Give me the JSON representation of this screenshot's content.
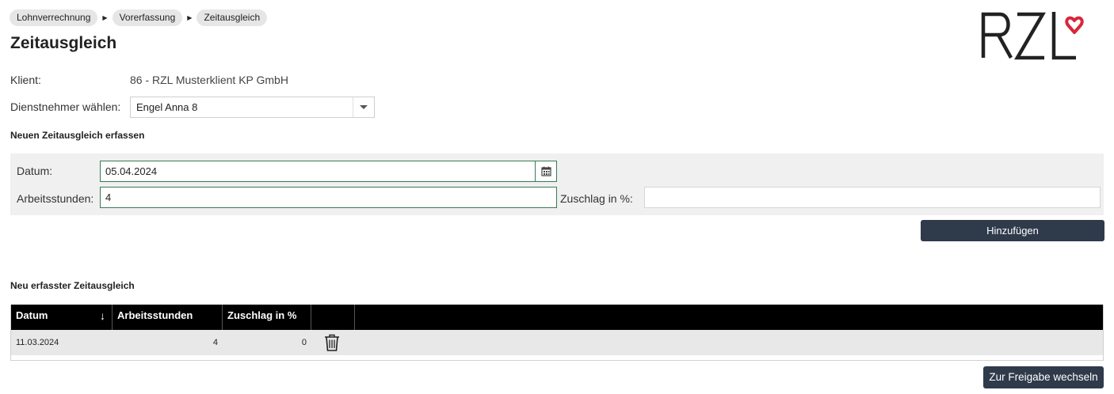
{
  "breadcrumb": [
    "Lohnverrechnung",
    "Vorerfassung",
    "Zeitausgleich"
  ],
  "page_title": "Zeitausgleich",
  "logo_text": "RZL",
  "client": {
    "label": "Klient:",
    "value": "86 - RZL Musterklient KP GmbH"
  },
  "employee": {
    "label": "Dienstnehmer wählen:",
    "selected": "Engel Anna 8"
  },
  "new_entry": {
    "heading": "Neuen Zeitausgleich erfassen",
    "date_label": "Datum:",
    "date_value": "05.04.2024",
    "hours_label": "Arbeitsstunden:",
    "hours_value": "4",
    "surcharge_label": "Zuschlag in %:",
    "surcharge_value": "",
    "add_button": "Hinzufügen"
  },
  "recorded": {
    "heading": "Neu erfasster Zeitausgleich",
    "columns": [
      "Datum",
      "Arbeitsstunden",
      "Zuschlag in %",
      ""
    ],
    "sort_indicator": "↓",
    "rows": [
      {
        "datum": "11.03.2024",
        "stunden": "4",
        "zuschlag": "0"
      }
    ]
  },
  "release_button": "Zur Freigabe wechseln",
  "colors": {
    "accent_dark": "#2f3b4b",
    "brand_red": "#d9263a",
    "input_focus": "#3a7a55"
  },
  "icons": {
    "calendar": "calendar-icon",
    "trash": "trash-icon",
    "dropdown": "chevron-down-icon"
  }
}
